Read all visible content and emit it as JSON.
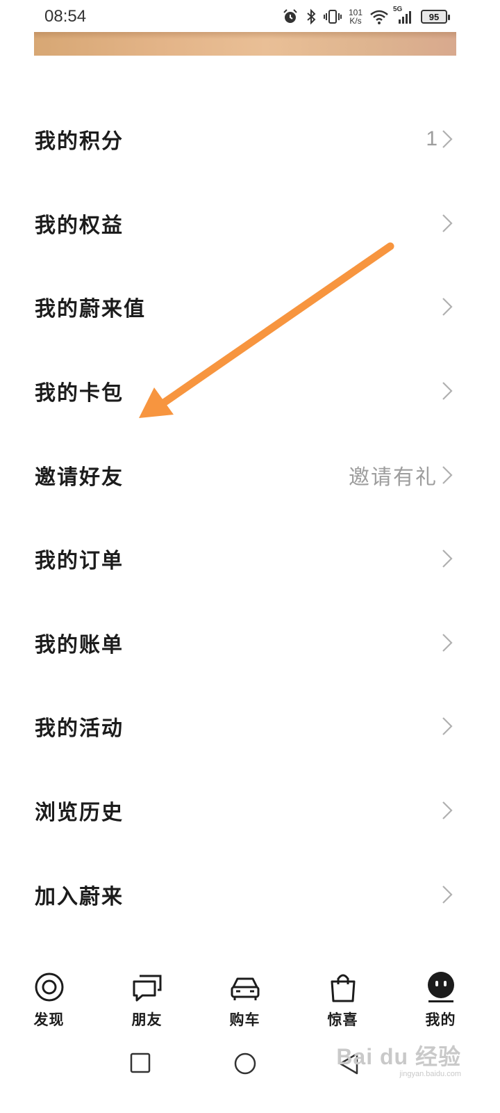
{
  "status_bar": {
    "time": "08:54",
    "net_speed_top": "101",
    "net_speed_bottom": "K/s",
    "network": "5G",
    "battery": "95",
    "icons": [
      "alarm-icon",
      "bluetooth-icon",
      "vibrate-icon",
      "wifi-icon",
      "cellular-signal-icon",
      "battery-icon"
    ]
  },
  "menu": {
    "items": [
      {
        "label": "我的积分",
        "value": "1"
      },
      {
        "label": "我的权益",
        "value": ""
      },
      {
        "label": "我的蔚来值",
        "value": ""
      },
      {
        "label": "我的卡包",
        "value": ""
      },
      {
        "label": "邀请好友",
        "value": "邀请有礼"
      },
      {
        "label": "我的订单",
        "value": ""
      },
      {
        "label": "我的账单",
        "value": ""
      },
      {
        "label": "我的活动",
        "value": ""
      },
      {
        "label": "浏览历史",
        "value": ""
      },
      {
        "label": "加入蔚来",
        "value": ""
      }
    ]
  },
  "tabbar": {
    "tabs": [
      {
        "label": "发现",
        "icon": "discover-icon"
      },
      {
        "label": "朋友",
        "icon": "chat-icon"
      },
      {
        "label": "购车",
        "icon": "car-icon"
      },
      {
        "label": "惊喜",
        "icon": "shopping-bag-icon"
      },
      {
        "label": "我的",
        "icon": "profile-face-icon"
      }
    ],
    "active_index": 4
  },
  "system_nav": {
    "icons": [
      "recents-square-icon",
      "home-circle-icon",
      "back-triangle-icon"
    ]
  },
  "watermark": {
    "main": "Bai du 经验",
    "sub": "jingyan.baidu.com"
  },
  "colors": {
    "annotation_arrow": "#f7953f",
    "text_primary": "#1c1c1c",
    "text_secondary": "#9d9d9d",
    "chevron": "#b0b0b0"
  }
}
